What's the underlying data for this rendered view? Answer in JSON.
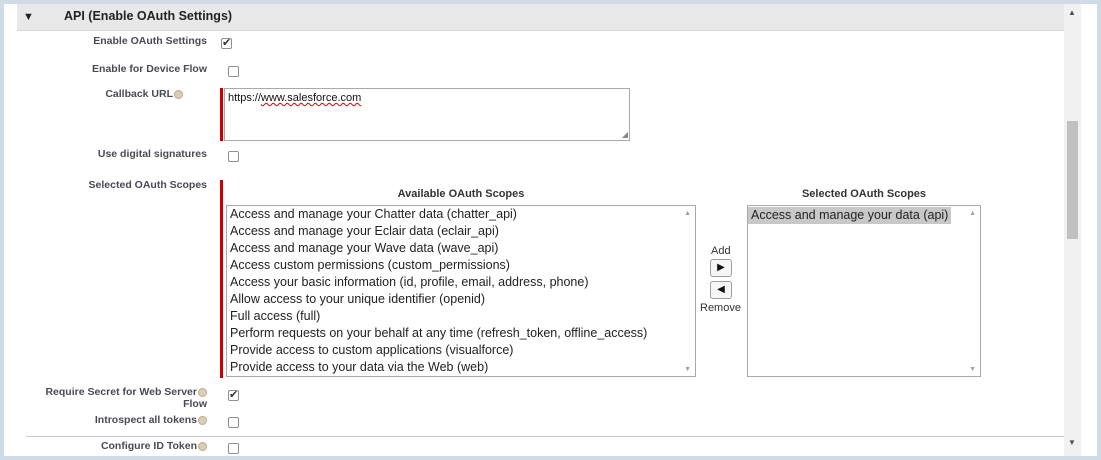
{
  "section": {
    "title": "API (Enable OAuth Settings)"
  },
  "fields": {
    "enable_oauth": {
      "label": "Enable OAuth Settings",
      "checked": true
    },
    "device_flow": {
      "label": "Enable for Device Flow",
      "checked": false
    },
    "callback_url": {
      "label": "Callback URL",
      "value_prefix": "https://",
      "value_link": "www.salesforce.com"
    },
    "digital_signatures": {
      "label": "Use digital signatures",
      "checked": false
    },
    "selected_scopes_label": "Selected OAuth Scopes",
    "require_secret": {
      "label_line1": "Require Secret for Web Server",
      "label_line2": "Flow",
      "checked": true
    },
    "introspect": {
      "label": "Introspect all tokens",
      "checked": false
    },
    "configure_id_token": {
      "label": "Configure ID Token",
      "checked": false
    }
  },
  "scopes": {
    "available_heading": "Available OAuth Scopes",
    "selected_heading": "Selected OAuth Scopes",
    "available": [
      "Access and manage your Chatter data (chatter_api)",
      "Access and manage your Eclair data (eclair_api)",
      "Access and manage your Wave data (wave_api)",
      "Access custom permissions (custom_permissions)",
      "Access your basic information (id, profile, email, address, phone)",
      "Allow access to your unique identifier (openid)",
      "Full access (full)",
      "Perform requests on your behalf at any time (refresh_token, offline_access)",
      "Provide access to custom applications (visualforce)",
      "Provide access to your data via the Web (web)"
    ],
    "selected": [
      "Access and manage your data (api)"
    ],
    "add_label": "Add",
    "remove_label": "Remove"
  },
  "icons": [
    "collapse-triangle-icon",
    "help-icon",
    "add-arrow-icon",
    "remove-arrow-icon",
    "scroll-up-icon",
    "scroll-down-icon"
  ],
  "colors": {
    "required": "#cc0000",
    "header_bg": "#e8e8e9",
    "label": "#4a4a56"
  }
}
